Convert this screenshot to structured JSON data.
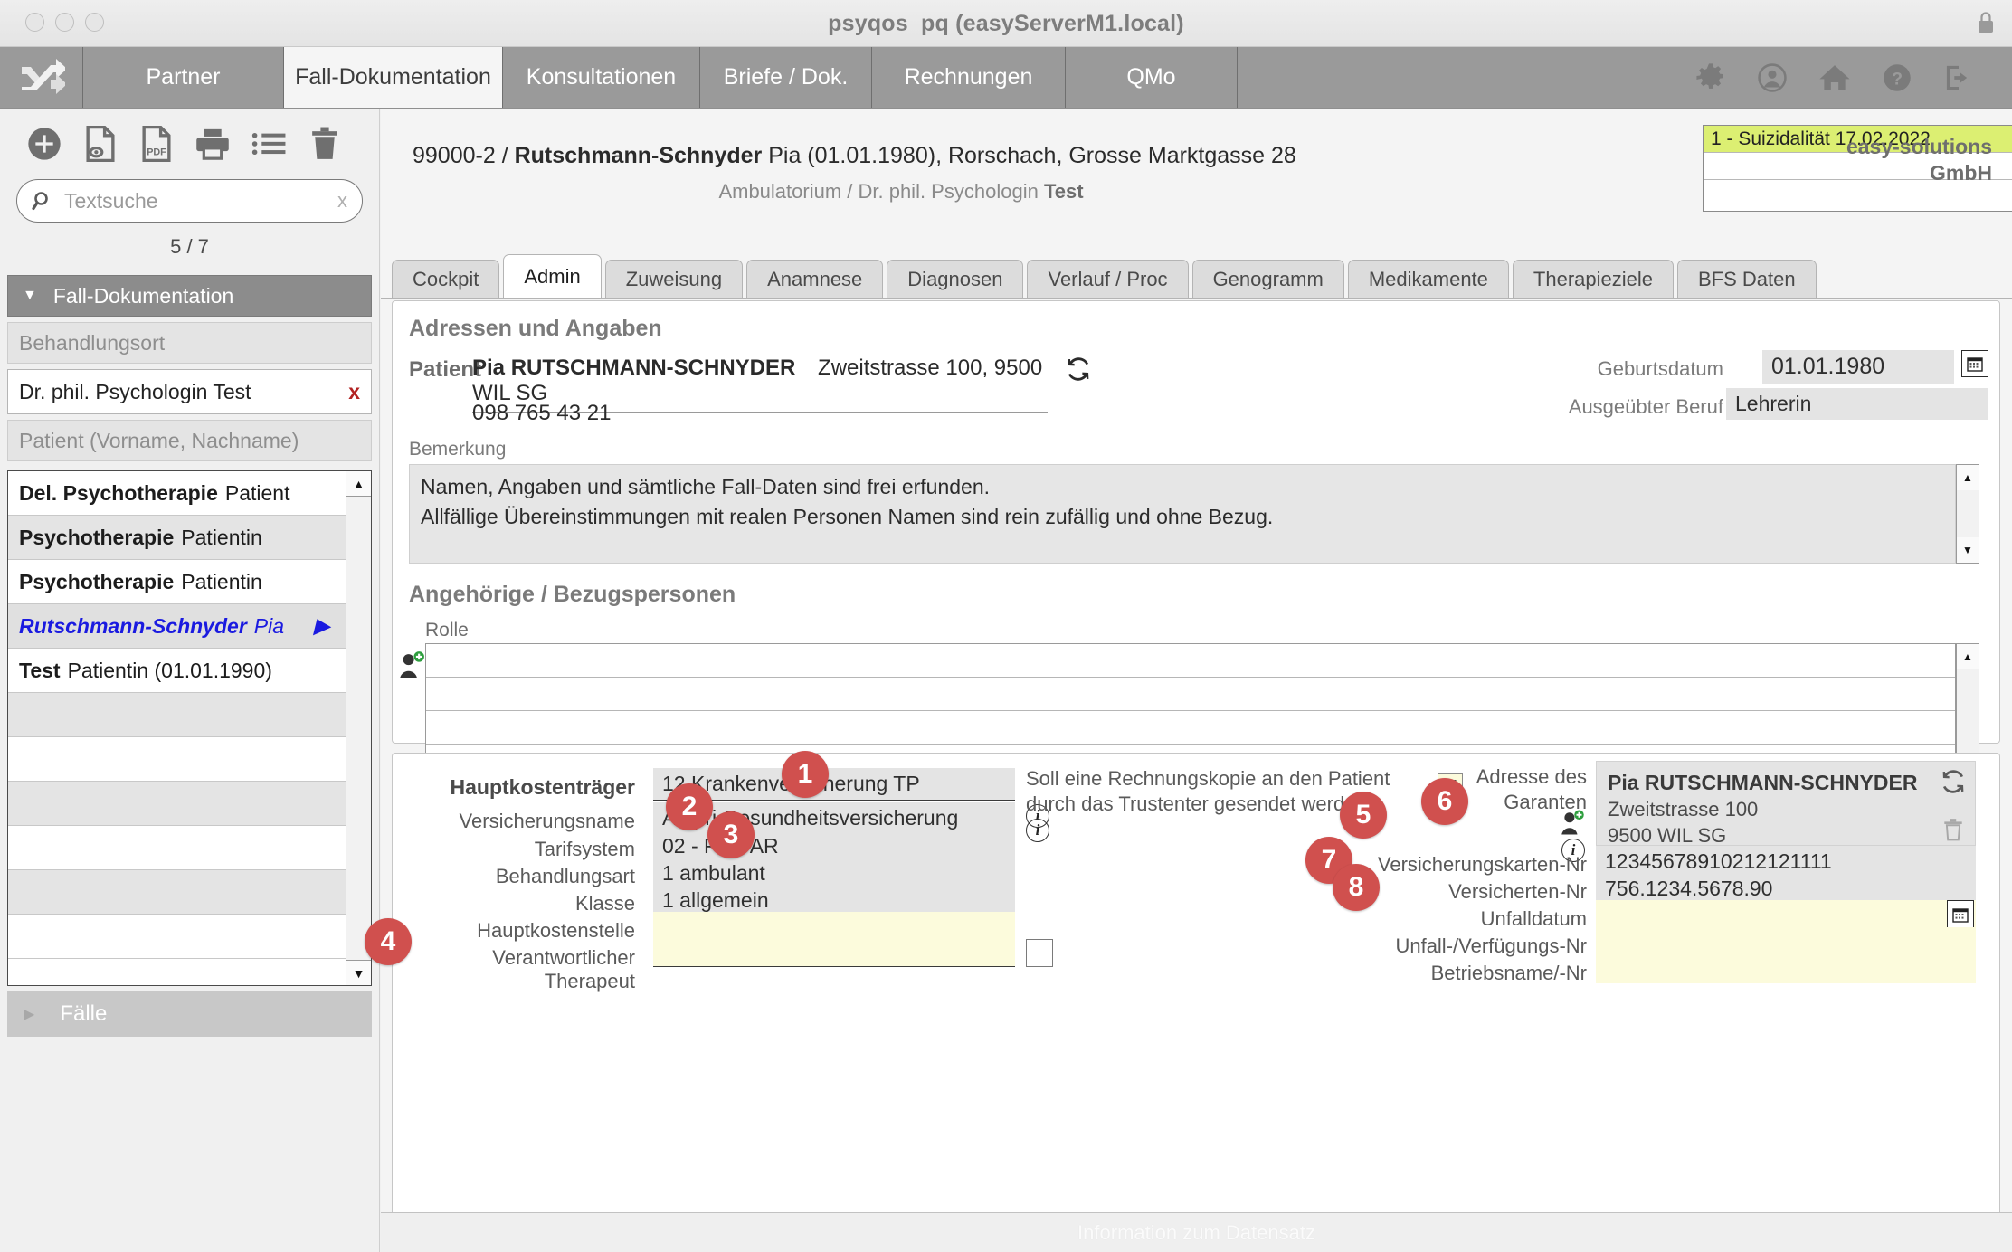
{
  "window": {
    "title": "psyqos_pq (easyServerM1.local)",
    "lock_icon": "lock-icon"
  },
  "mainnav": {
    "logo_icon": "shuffle-logo-icon",
    "tabs": [
      {
        "label": "Partner",
        "active": false
      },
      {
        "label": "Fall-Dokumentation",
        "active": true
      },
      {
        "label": "Konsultationen",
        "active": false
      },
      {
        "label": "Briefe / Dok.",
        "active": false
      },
      {
        "label": "Rechnungen",
        "active": false
      },
      {
        "label": "QMo",
        "active": false
      }
    ],
    "icons": [
      "gear-icon",
      "user-circle-icon",
      "home-icon",
      "help-icon",
      "logout-icon"
    ]
  },
  "sidebar": {
    "toolbar_icons": [
      "add-icon",
      "preview-document-icon",
      "pdf-icon",
      "print-icon",
      "list-icon",
      "delete-icon"
    ],
    "search": {
      "value": "",
      "placeholder": "Textsuche",
      "clear_label": "x",
      "icon": "search-icon"
    },
    "pager": "5 / 7",
    "section_title": "Fall-Dokumentation",
    "filter_behandlungsort_placeholder": "Behandlungsort",
    "filter_behandlungsort_value": "Dr. phil. Psychologin Test",
    "filter_clear": "x",
    "filter_patient_placeholder": "Patient (Vorname, Nachname)",
    "list": [
      {
        "bold": "Del. Psychotherapie",
        "rest": "Patient",
        "selected": false
      },
      {
        "bold": "Psychotherapie",
        "rest": "Patientin",
        "selected": false
      },
      {
        "bold": "Psychotherapie",
        "rest": "Patientin",
        "selected": false
      },
      {
        "bold": "Rutschmann-Schnyder",
        "rest": "Pia",
        "selected": true
      },
      {
        "bold": "Test",
        "rest": "Patientin (01.01.1990)",
        "selected": false
      },
      {
        "bold": "",
        "rest": "",
        "selected": false
      },
      {
        "bold": "",
        "rest": "",
        "selected": false
      },
      {
        "bold": "",
        "rest": "",
        "selected": false
      },
      {
        "bold": "",
        "rest": "",
        "selected": false
      },
      {
        "bold": "",
        "rest": "",
        "selected": false
      },
      {
        "bold": "",
        "rest": "",
        "selected": false
      }
    ],
    "faelle_label": "Fälle"
  },
  "patient_header": {
    "case_number": "99000-2 / ",
    "name_bold": "Rutschmann-Schnyder",
    "name_rest": " Pia (01.01.1980), Rorschach, Grosse Marktgasse 28",
    "subtitle_pre": "Ambulatorium / Dr. phil. Psychologin ",
    "subtitle_bold": "Test"
  },
  "alerts": {
    "warn_icon": "warning-add-icon",
    "rows": [
      "1 - Suizidalität 17.02.2022",
      "",
      ""
    ]
  },
  "brand": {
    "line1": "easy-solutions",
    "line2": "GmbH"
  },
  "tabs": [
    {
      "label": "Cockpit",
      "active": false
    },
    {
      "label": "Admin",
      "active": true
    },
    {
      "label": "Zuweisung",
      "active": false
    },
    {
      "label": "Anamnese",
      "active": false
    },
    {
      "label": "Diagnosen",
      "active": false
    },
    {
      "label": "Verlauf / Proc",
      "active": false
    },
    {
      "label": "Genogramm",
      "active": false
    },
    {
      "label": "Medikamente",
      "active": false
    },
    {
      "label": "Therapieziele",
      "active": false
    },
    {
      "label": "BFS Daten",
      "active": false
    }
  ],
  "adressen": {
    "title": "Adressen und Angaben",
    "patient_label": "Patient",
    "patient_name": "Pia RUTSCHMANN-SCHNYDER",
    "patient_address": "Zweitstrasse 100, 9500   WIL SG",
    "patient_phone": "098 765 43 21",
    "refresh_icon": "refresh-icon",
    "geburtsdatum_label": "Geburtsdatum",
    "geburtsdatum_value": "01.01.1980",
    "calendar_icon": "calendar-icon",
    "beruf_label": "Ausgeübter Beruf",
    "beruf_value": "Lehrerin",
    "bemerkung_label": "Bemerkung",
    "bemerkung_line1": "Namen, Angaben und sämtliche Fall-Daten sind frei erfunden.",
    "bemerkung_line2": "Allfällige Übereinstimmungen mit realen Personen Namen sind rein zufällig und ohne Bezug."
  },
  "angehoerige": {
    "title": "Angehörige / Bezugspersonen",
    "rolle_label": "Rolle",
    "add_person_icon": "add-person-icon",
    "row_count": 5
  },
  "kosten": {
    "hauptkostentraeger_label": "Hauptkostenträger",
    "hauptkostentraeger_value": "12 Krankenversicherung TP",
    "versicherungsname_label": "Versicherungsname",
    "versicherungsname_value": "Atupri Gesundheitsversicherung",
    "versicherungsname_info_icon": "info-icon",
    "tarifsystem_label": "Tarifsystem",
    "tarifsystem_value": "02 - PsyTAR",
    "behandlungsart_label": "Behandlungsart",
    "behandlungsart_value": "1 ambulant",
    "klasse_label": "Klasse",
    "klasse_value": "1 allgemein",
    "hauptkostenstelle_label": "Hauptkostenstelle",
    "hauptkostenstelle_value": "",
    "verantwortlicher_label": "Verantwortlicher Therapeut",
    "verantwortlicher_value": "",
    "trustcenter_q_line1": "Soll eine Rechnungskopie an den Patient",
    "trustcenter_q_line2": "durch das Trustenter gesendet werden?",
    "trustcenter_checked": "✔",
    "trustcenter_info_icon": "info-icon",
    "garant_label_line1": "Adresse des",
    "garant_label_line2": "Garanten",
    "garant_add_icon": "add-person-icon",
    "garant_info_icon": "info-icon",
    "garant_name": "Pia RUTSCHMANN-SCHNYDER",
    "garant_street": "Zweitstrasse 100",
    "garant_city": "9500   WIL SG",
    "garant_refresh_icon": "refresh-icon",
    "garant_delete_icon": "trash-icon",
    "versicherungskarten_label": "Versicherungskarten-Nr",
    "versicherungskarten_value": "12345678910212121111",
    "versicherten_label": "Versicherten-Nr",
    "versicherten_value": "756.1234.5678.90",
    "unfalldatum_label": "Unfalldatum",
    "unfalldatum_value": "",
    "unfalldatum_icon": "calendar-icon",
    "unfall_nr_label": "Unfall-/Verfügungs-Nr",
    "unfall_nr_value": "",
    "betriebsname_label": "Betriebsname/-Nr",
    "betriebsname_value": "",
    "badges": [
      "1",
      "2",
      "3",
      "4",
      "5",
      "6",
      "7",
      "8"
    ]
  },
  "statusbar": {
    "text": "Information zum Datensatz"
  },
  "colors": {
    "accent_red": "#d0504e",
    "nav_gray": "#9a9a9a",
    "highlight_yellow": "#dcef72",
    "editable_field": "#fcfbdc",
    "readonly_field": "#e4e4e4",
    "selected_blue": "#1a1ae0"
  }
}
